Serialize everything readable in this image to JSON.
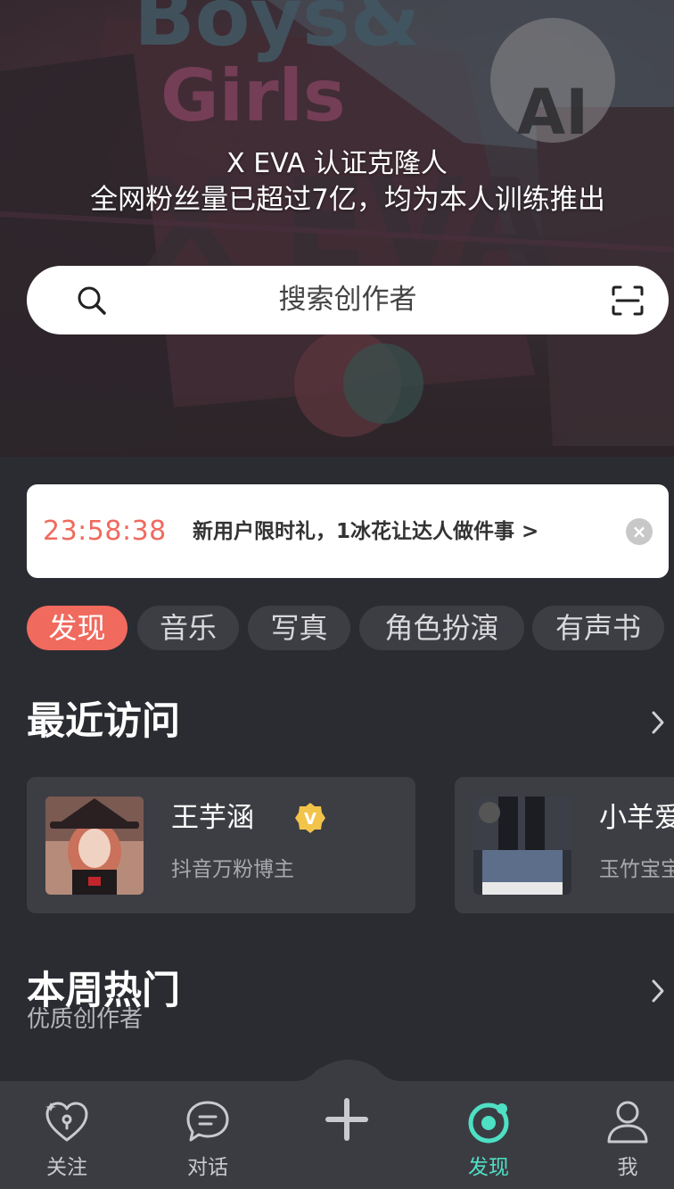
{
  "hero": {
    "title": "X EVA 认证克隆人",
    "subtitle": "全网粉丝量已超过7亿，均为本人训练推出"
  },
  "search": {
    "placeholder": "搜索创作者"
  },
  "promo": {
    "timer": "23:58:38",
    "text": "新用户限时礼，1冰花让达人做件事 >"
  },
  "tabs": [
    "发现",
    "音乐",
    "写真",
    "角色扮演",
    "有声书"
  ],
  "recent": {
    "title": "最近访问",
    "items": [
      {
        "name": "王芋涵",
        "desc": "抖音万粉博主",
        "verified": true
      },
      {
        "name": "小羊爱",
        "desc": "玉竹宝宝",
        "verified": false
      }
    ]
  },
  "weekly": {
    "title": "本周热门",
    "subtitle": "优质创作者"
  },
  "nav": {
    "items": [
      "关注",
      "对话",
      "发现",
      "我"
    ],
    "active": "发现"
  },
  "colors": {
    "accent": "#f06a5e",
    "nav_active": "#4ee0c4",
    "background": "#2b2c31"
  }
}
